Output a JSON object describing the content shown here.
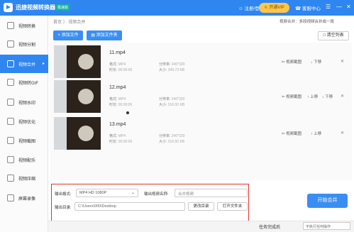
{
  "app": {
    "title": "迅捷视频转换器",
    "version_badge": "极速版"
  },
  "topbar": {
    "user_label": "注册/登录",
    "vip_label": "开通VIP",
    "service_label": "客服中心",
    "window_controls": [
      "☰",
      "—",
      "✕"
    ]
  },
  "sidebar": {
    "items": [
      {
        "label": "视频转换",
        "icon": "video-convert-icon"
      },
      {
        "label": "视频分割",
        "icon": "video-split-icon"
      },
      {
        "label": "视频合并",
        "icon": "video-merge-icon",
        "active": true
      },
      {
        "label": "视频转GIF",
        "icon": "gif-icon"
      },
      {
        "label": "视频水印",
        "icon": "watermark-icon"
      },
      {
        "label": "视频优化",
        "icon": "optimize-icon"
      },
      {
        "label": "视频截图",
        "icon": "screenshot-icon"
      },
      {
        "label": "视频配乐",
        "icon": "music-icon"
      },
      {
        "label": "视频压缩",
        "icon": "compress-icon"
      },
      {
        "label": "屏幕录像",
        "icon": "screen-record-icon"
      }
    ]
  },
  "breadcrumb": "首页 〉 视频合并",
  "batch_compare": "视频合并：多段视频合并成一段",
  "toolbar": {
    "add_file": "+ 添加文件",
    "add_folder": "添加文件夹",
    "clear_list": "清空列表"
  },
  "files": [
    {
      "name": "11.mp4",
      "format_label": "格式:",
      "format": "MP4",
      "resolution_label": "分辨率:",
      "resolution": "240*320",
      "duration_label": "时长:",
      "duration": "00:00:06",
      "size_label": "大小:",
      "size": "349.73 KB",
      "screenshot": "视频截图",
      "move": "下移"
    },
    {
      "name": "12.mp4",
      "format_label": "格式:",
      "format": "MP4",
      "resolution_label": "分辨率:",
      "resolution": "240*320",
      "duration_label": "时长:",
      "duration": "00:00:06",
      "size_label": "大小:",
      "size": "316.92 KB",
      "screenshot": "视频截图",
      "move_up": "上移",
      "move": "下移"
    },
    {
      "name": "13.mp4",
      "format_label": "格式:",
      "format": "MP4",
      "resolution_label": "分辨率:",
      "resolution": "240*320",
      "duration_label": "时长:",
      "duration": "00:00:06",
      "size_label": "大小:",
      "size": "316.92 KB",
      "screenshot": "视频截图",
      "move_up": "上移"
    }
  ],
  "output": {
    "format_label": "输出格式:",
    "format_value": "MP4  HD 1080P",
    "name_label": "输出视频名称:",
    "name_value": "合并视频",
    "dir_label": "输出目录:",
    "dir_value": "C:\\Users\\000\\Desktop",
    "change_dir": "更改目录",
    "open_folder": "打开文件夹"
  },
  "start_button": "开始合并",
  "status": {
    "task_done_label": "任务完成后",
    "after_done_value": "不执行任何操作"
  },
  "colors": {
    "accent": "#2f86f0",
    "highlight_outline": "#e5322d",
    "vip": "#ffc64a"
  }
}
